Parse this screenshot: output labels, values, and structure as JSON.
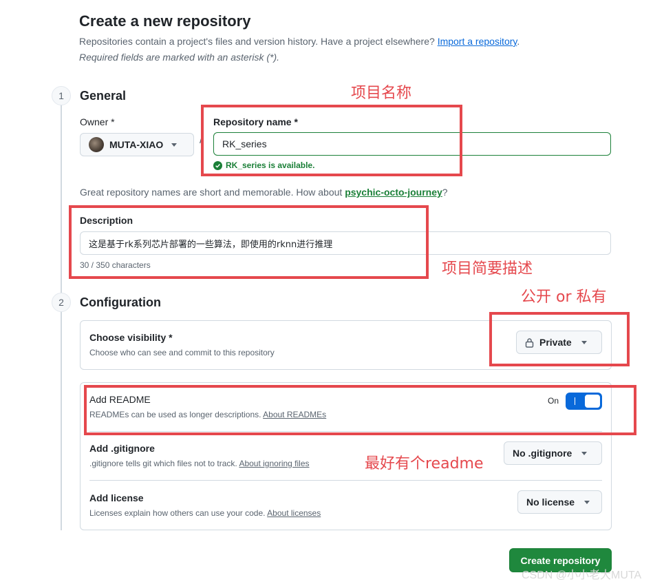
{
  "header": {
    "title": "Create a new repository",
    "subtitle": "Repositories contain a project's files and version history. Have a project elsewhere?",
    "import_link": "Import a repository",
    "import_suffix": ".",
    "required_note": "Required fields are marked with an asterisk (*)."
  },
  "general": {
    "step": "1",
    "title": "General",
    "owner_label": "Owner *",
    "owner_value": "MUTA-XIAO",
    "slash": "/",
    "repo_label": "Repository name *",
    "repo_value": "RK_series",
    "availability": "RK_series is available.",
    "suggestion_prefix": "Great repository names are short and memorable. How about",
    "suggestion_name": "psychic-octo-journey",
    "suggestion_suffix": "?",
    "description_label": "Description",
    "description_value": "这是基于rk系列芯片部署的一些算法，即使用的rknn进行推理",
    "char_count": "30 / 350 characters"
  },
  "configuration": {
    "step": "2",
    "title": "Configuration",
    "visibility_label": "Choose visibility *",
    "visibility_hint": "Choose who can see and commit to this repository",
    "visibility_value": "Private",
    "readme_label": "Add README",
    "readme_hint": "READMEs can be used as longer descriptions.",
    "readme_link": "About READMEs",
    "readme_toggle_text": "On",
    "readme_enabled": true,
    "gitignore_label": "Add .gitignore",
    "gitignore_hint": ".gitignore tells git which files not to track.",
    "gitignore_link": "About ignoring files",
    "gitignore_value": "No .gitignore",
    "license_label": "Add license",
    "license_hint": "Licenses explain how others can use your code.",
    "license_link": "About licenses",
    "license_value": "No license"
  },
  "submit_label": "Create repository",
  "annotations": {
    "name": "项目名称",
    "description": "项目简要描述",
    "visibility": "公开 or 私有",
    "readme": "最好有个readme"
  },
  "watermark": "CSDN @小小老大MUTA",
  "colors": {
    "accent_blue": "#0969da",
    "success_green": "#1a7f37",
    "primary_button": "#1f883d",
    "annotation_red": "#e5484d"
  },
  "icons": [
    "check-circle-icon",
    "lock-icon",
    "chevron-down-icon",
    "avatar"
  ]
}
